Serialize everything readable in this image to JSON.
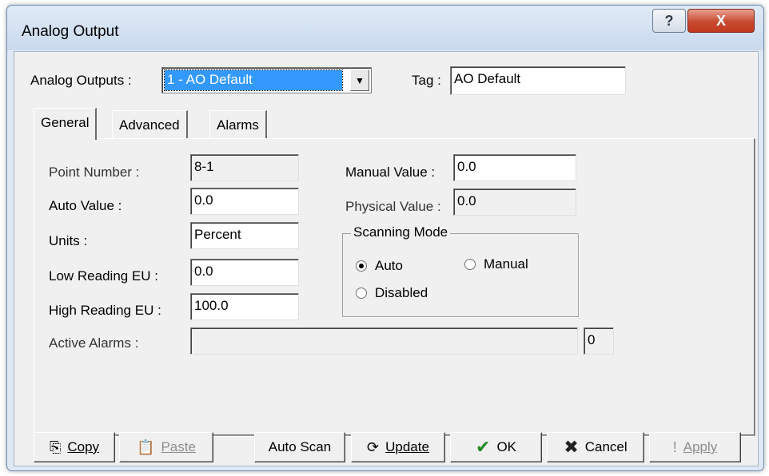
{
  "window": {
    "title": "Analog Output",
    "help_label": "?",
    "close_label": "X"
  },
  "header": {
    "analog_outputs_label": "Analog Outputs :",
    "analog_outputs_value": "1 - AO Default",
    "tag_label": "Tag :",
    "tag_value": "AO Default"
  },
  "tabs": [
    {
      "label": "General",
      "active": true
    },
    {
      "label": "Advanced",
      "active": false
    },
    {
      "label": "Alarms",
      "active": false
    }
  ],
  "general": {
    "point_number": {
      "label": "Point Number :",
      "value": "8-1"
    },
    "auto_value": {
      "label": "Auto Value :",
      "value": "0.0"
    },
    "units": {
      "label": "Units :",
      "value": "Percent"
    },
    "low_reading": {
      "label": "Low Reading EU :",
      "value": "0.0"
    },
    "high_reading": {
      "label": "High Reading EU :",
      "value": "100.0"
    },
    "active_alarms": {
      "label": "Active Alarms :",
      "value": "",
      "count": "0"
    },
    "manual_value": {
      "label": "Manual Value :",
      "value": "0.0"
    },
    "physical_value": {
      "label": "Physical Value :",
      "value": "0.0"
    },
    "scanning_mode": {
      "title": "Scanning Mode",
      "auto": "Auto",
      "manual": "Manual",
      "disabled": "Disabled",
      "selected": "Auto"
    }
  },
  "buttons": {
    "copy": "Copy",
    "paste": "Paste",
    "auto_scan": "Auto Scan",
    "update": "Update",
    "ok": "OK",
    "cancel": "Cancel",
    "apply": "Apply"
  },
  "colors": {
    "selection": "#3399ff",
    "ok_check": "#1f8a1f",
    "cancel_x": "#222222",
    "close_button": "#c74a30"
  }
}
